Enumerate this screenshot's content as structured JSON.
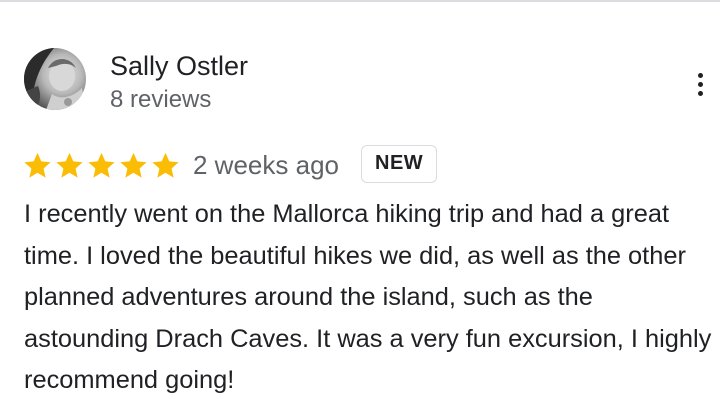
{
  "review": {
    "reviewer_name": "Sally Ostler",
    "review_count": "8 reviews",
    "rating": 5,
    "rating_max": 5,
    "date": "2 weeks ago",
    "badge": "NEW",
    "text": "I recently went on the Mallorca hiking trip and had a great time. I loved the beautiful hikes we did, as well as the other planned adventures around the island, such as the astounding Drach Caves. It was a very fun excursion, I highly recommend going!",
    "more_icon": "more-vert-icon",
    "star_icon": "star-icon"
  },
  "colors": {
    "star": "#fbbc04",
    "secondary_text": "#5f6368",
    "primary_text": "#202124",
    "divider": "#dadce0"
  }
}
